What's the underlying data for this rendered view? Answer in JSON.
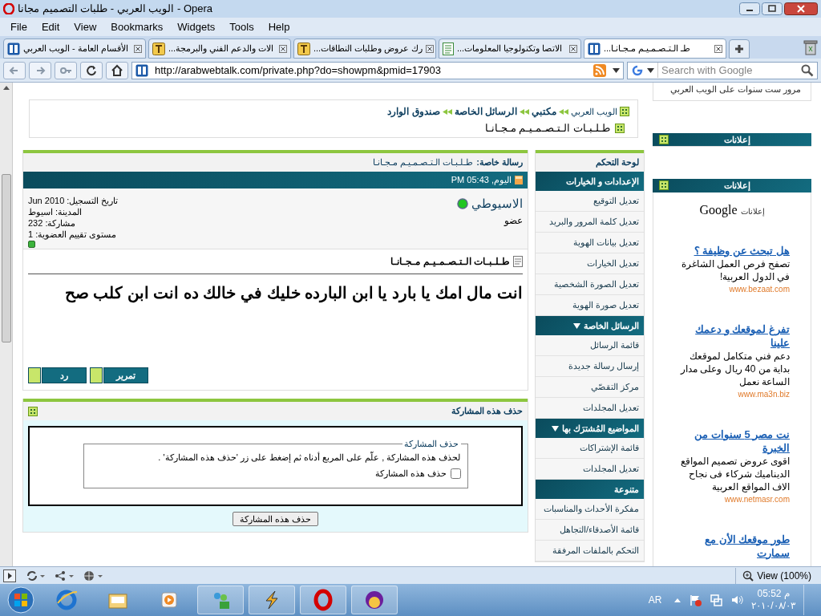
{
  "window": {
    "title": "الويب العربي - طلبات التصميم مجانا - Opera"
  },
  "menu": [
    "Help",
    "Tools",
    "Widgets",
    "Bookmarks",
    "View",
    "Edit",
    "File"
  ],
  "tabs": [
    {
      "label": "...طـ الـتـصـمـيـم مـجـانـا",
      "kind": "site",
      "selected": true
    },
    {
      "label": "...الاتصا وتكنولوجيا المعلومات",
      "kind": "page",
      "selected": false
    },
    {
      "label": "...رك عروض وطلبات النطاقات",
      "kind": "forum",
      "selected": false
    },
    {
      "label": "...الات والدعم الفني والبرمجة",
      "kind": "forum",
      "selected": false
    },
    {
      "label": "الأقسام العامة - الويب العربي",
      "kind": "site",
      "selected": false
    }
  ],
  "address": {
    "url": "http://arabwebtalk.com/private.php?do=showpm&pmid=17903",
    "search_placeholder": "Search with Google"
  },
  "breadcrumb": {
    "items": [
      "الويب العربي",
      "مكتبي",
      "الرسائل الخاصة",
      "صندوق الوارد"
    ],
    "current": "طـلـبـات الـتـصـمـيـم مـجـانـا"
  },
  "message": {
    "label": "رسالة خاصة:",
    "title": "طـلـبـات الـتـصـمـيـم مـجـانـا",
    "date": "اليوم, 05:43 PM",
    "author": {
      "name": "الاسيوطي",
      "online": true,
      "role": "عضو",
      "info": [
        "تاريخ التسجيل: Jun 2010",
        "المدينة: اسيوط",
        "مشاركة: 232",
        "مستوى تقييم العضوية: 1"
      ]
    },
    "post_title": "طـلـبـات الـتـصـمـيـم مـجـانـا",
    "body": "انت مال امك يا بارد يا ابن البارده خليك في خالك ده انت ابن كلب صح",
    "buttons": [
      "تمرير",
      "رد"
    ]
  },
  "delete": {
    "title": "حذف هذه المشاركة",
    "legend": "حذف المشاركة",
    "instructions": "لحذف هذه المشاركة , علّم على المربع أدناه ثم إضغط على زر 'حذف هذه المشاركة' .",
    "checkbox": {
      "label": "حذف هذه المشاركة",
      "checked": false
    },
    "button": "حذف هذه المشاركة"
  },
  "sidebar": {
    "title": "لوحة التحكم",
    "sections": [
      {
        "title": "الإعدادات و الخيارات",
        "collapsible": false,
        "items": [
          "تعديل التوقيع",
          "تعديل كلمة المرور والبريد",
          "تعديل بيانات الهوية",
          "تعديل الخيارات",
          "تعديل الصورة الشخصية",
          "تعديل صورة الهوية"
        ]
      },
      {
        "title": "الرسائل الخاصة",
        "collapsible": true,
        "items": [
          "قائمة الرسائل",
          "إرسال رسالة جديدة",
          "مركز التقصّي",
          "تعديل المجلدات"
        ]
      },
      {
        "title": "المواضيع المُشترَك بها",
        "collapsible": true,
        "items": [
          "قائمة الإشتراكات",
          "تعديل المجلدات"
        ]
      },
      {
        "title": "متنوعة",
        "collapsible": false,
        "items": [
          "مفكرة الأحداث والمناسبات",
          "قائمة الأصدقاء/التجاهل",
          "التحكم بالملفات المرفقة"
        ]
      }
    ]
  },
  "right_column": {
    "news": "مرور ست سنوات على الويب العربي",
    "ads_headers": [
      "إعلانات",
      "إعلانات"
    ],
    "ads_label": "إعلانات",
    "ads_brand": "Google",
    "ads": [
      {
        "title": "هل تبحث عن وظيفة ؟",
        "body": "تصفح فرص العمل الشاغرة في الدول العربية!",
        "url": "www.bezaat.com"
      },
      {
        "title": "تفرغ لموقعك و دعمك علينا",
        "body": "دعم فني متكامل لموقعك بداية من 40 ريال وعلى مدار الساعة نعمل",
        "url": "www.ma3n.biz"
      },
      {
        "title": "نت مصر 5 سنوات من الخبرة",
        "body": "اقوى عروض تصميم المواقع الديناميك شركاء فى نجاح الاف المواقع العربية",
        "url": "www.netmasr.com"
      },
      {
        "title": "طور موقعك الأن مع سمارت"
      }
    ]
  },
  "status_bar": {
    "zoom": "View (100%)"
  },
  "taskbar": {
    "language": "AR",
    "time": "05:52 م",
    "date": "٢٠١٠/٠٨/٠٣"
  }
}
